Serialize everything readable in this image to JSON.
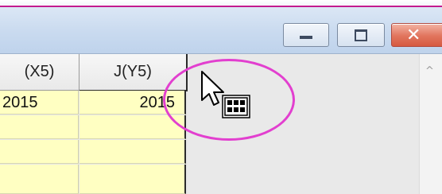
{
  "window": {
    "controls": {
      "minimize_icon": "minimize-icon",
      "maximize_icon": "maximize-icon",
      "close_icon": "close-icon",
      "close_glyph": "✕"
    }
  },
  "worksheet": {
    "columns": [
      {
        "header": "(X5)"
      },
      {
        "header": "J(Y5)"
      }
    ],
    "rows": [
      [
        "2015",
        "2015"
      ],
      [
        "",
        ""
      ],
      [
        "",
        ""
      ],
      [
        "",
        ""
      ]
    ]
  },
  "annotation": {
    "ring_color": "#e23fcf",
    "cursor": "arrow-cursor-with-table-icon"
  },
  "scrollbar": {
    "up_arrow": "^"
  }
}
